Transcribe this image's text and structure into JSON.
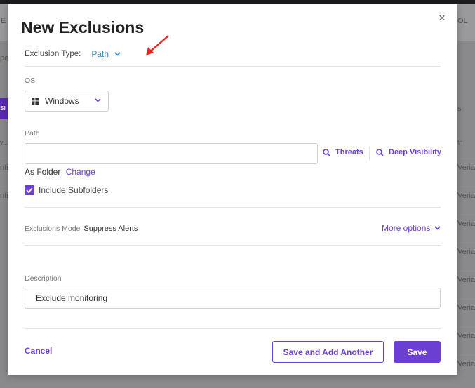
{
  "background": {
    "header_left_text": "E",
    "header_right_text": "OL",
    "left_text_2": "pe",
    "purple_button_text": "si",
    "right_text_s": "s",
    "table_header_left": "y...",
    "table_header_right": "th",
    "left_rows": [
      "nti",
      "nti"
    ],
    "right_rows": [
      "Veriat",
      "Veriat",
      "Veriat",
      "Veriat",
      "Veriat",
      "Veriat",
      "Veriat",
      "Veriat"
    ]
  },
  "modal": {
    "title": "New Exclusions",
    "close_label": "×",
    "exclusion_type": {
      "label": "Exclusion Type:",
      "value": "Path"
    },
    "os": {
      "label": "OS",
      "value": "Windows"
    },
    "path": {
      "label": "Path",
      "value": "",
      "placeholder": "",
      "threats_link": "Threats",
      "deep_visibility_link": "Deep Visibility",
      "folder_text": "As Folder",
      "change_link": "Change",
      "include_subfolders_label": "Include Subfolders",
      "include_subfolders_checked": true
    },
    "exclusions_mode": {
      "label": "Exclusions Mode",
      "value": "Suppress Alerts"
    },
    "more_options_label": "More options",
    "description": {
      "label": "Description",
      "value": "Exclude monitoring"
    },
    "buttons": {
      "cancel": "Cancel",
      "save_and_add_another": "Save and Add Another",
      "save": "Save"
    }
  },
  "colors": {
    "accent": "#6b3fd1",
    "type_link": "#2f8ad8",
    "annotation_arrow": "#e8231b"
  }
}
